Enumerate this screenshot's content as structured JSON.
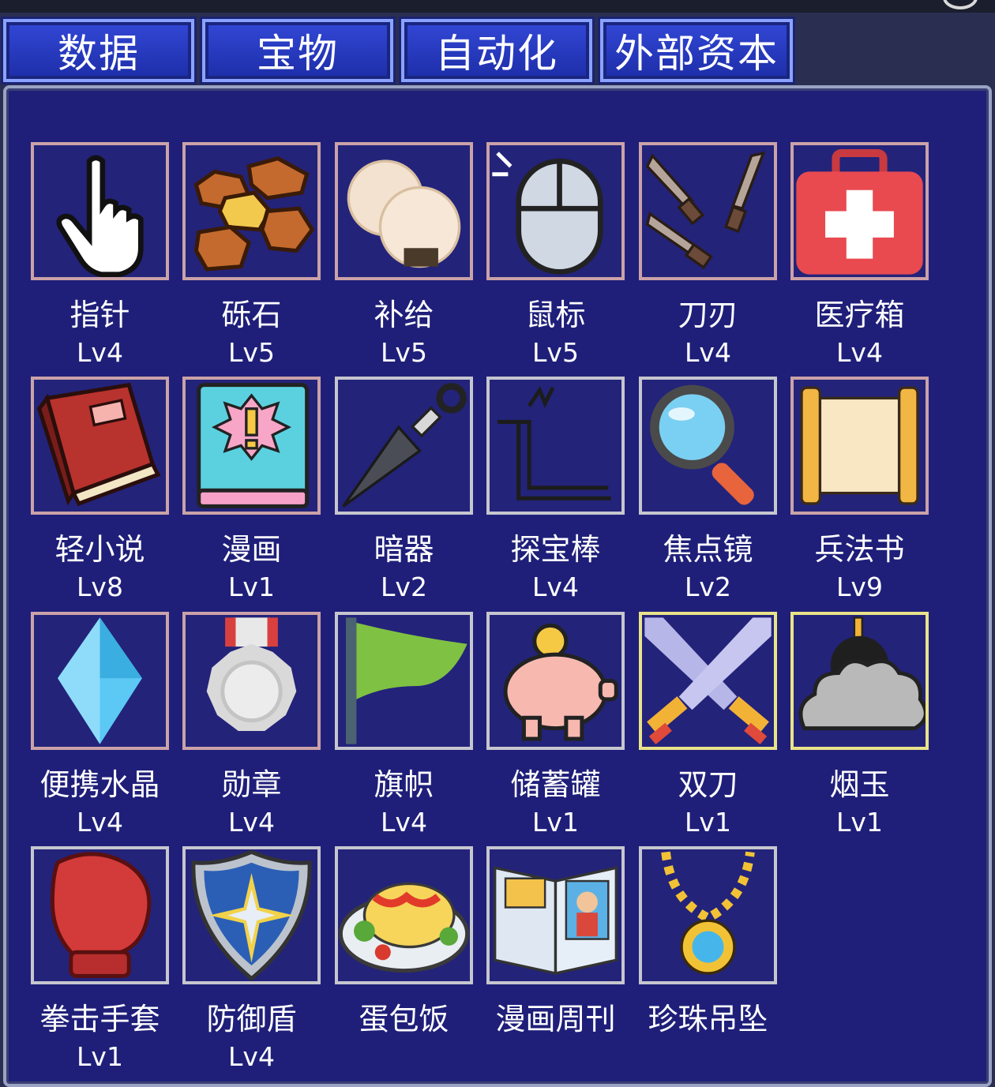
{
  "tabs": [
    {
      "label": "数据"
    },
    {
      "label": "宝物"
    },
    {
      "label": "自动化"
    },
    {
      "label": "外部资本"
    }
  ],
  "items": [
    {
      "name": "指针",
      "level": "Lv4",
      "icon": "pointer-hand-icon"
    },
    {
      "name": "砾石",
      "level": "Lv5",
      "icon": "gravel-icon"
    },
    {
      "name": "补给",
      "level": "Lv5",
      "icon": "rice-ball-icon"
    },
    {
      "name": "鼠标",
      "level": "Lv5",
      "icon": "mouse-icon"
    },
    {
      "name": "刀刃",
      "level": "Lv4",
      "icon": "knives-icon"
    },
    {
      "name": "医疗箱",
      "level": "Lv4",
      "icon": "first-aid-kit-icon"
    },
    {
      "name": "轻小说",
      "level": "Lv8",
      "icon": "light-novel-book-icon"
    },
    {
      "name": "漫画",
      "level": "Lv1",
      "icon": "comic-book-icon"
    },
    {
      "name": "暗器",
      "level": "Lv2",
      "icon": "kunai-icon"
    },
    {
      "name": "探宝棒",
      "level": "Lv4",
      "icon": "dowsing-rod-icon"
    },
    {
      "name": "焦点镜",
      "level": "Lv2",
      "icon": "magnifying-glass-icon"
    },
    {
      "name": "兵法书",
      "level": "Lv9",
      "icon": "scroll-icon"
    },
    {
      "name": "便携水晶",
      "level": "Lv4",
      "icon": "crystal-icon"
    },
    {
      "name": "勋章",
      "level": "Lv4",
      "icon": "medal-icon"
    },
    {
      "name": "旗帜",
      "level": "Lv4",
      "icon": "flag-icon"
    },
    {
      "name": "储蓄罐",
      "level": "Lv1",
      "icon": "piggy-bank-icon"
    },
    {
      "name": "双刀",
      "level": "Lv1",
      "icon": "crossed-swords-icon"
    },
    {
      "name": "烟玉",
      "level": "Lv1",
      "icon": "smoke-bomb-icon"
    },
    {
      "name": "拳击手套",
      "level": "Lv1",
      "icon": "boxing-glove-icon"
    },
    {
      "name": "防御盾",
      "level": "Lv4",
      "icon": "shield-icon"
    },
    {
      "name": "蛋包饭",
      "level": "",
      "icon": "omelette-rice-icon"
    },
    {
      "name": "漫画周刊",
      "level": "",
      "icon": "comic-weekly-icon"
    },
    {
      "name": "珍珠吊坠",
      "level": "",
      "icon": "pearl-pendant-icon"
    }
  ],
  "colors": {
    "panel_bg": "#1f1f7a",
    "tab_bg": "#2438c4",
    "frame_default": "#caa2a8",
    "frame_silver": "#c6c6cf",
    "frame_gold": "#e9e38a"
  }
}
